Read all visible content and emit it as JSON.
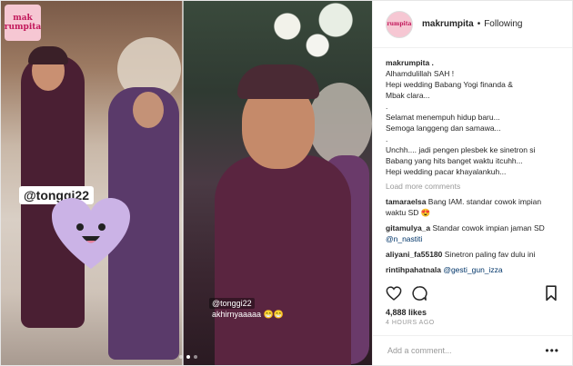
{
  "brand": {
    "logo_line1": "mak",
    "logo_line2": "rumpita"
  },
  "media": {
    "tag_text": "@tonggi22",
    "sticker_user": "@tonggi22",
    "sticker_text": "akhirnyaaaaa 😁😁",
    "carousel_dots": 3,
    "active_dot": 1
  },
  "header": {
    "username": "makrumpita",
    "separator": "•",
    "follow_status": "Following"
  },
  "caption": {
    "username": "makrumpita .",
    "lines": [
      "Alhamdulillah SAH !",
      "Hepi wedding Babang Yogi finanda &",
      "Mbak clara...",
      ".",
      "Selamat menempuh hidup baru...",
      "Semoga langgeng dan samawa...",
      ".",
      "Unchh.... jadi pengen plesbek ke sinetron si",
      "Babang yang hits banget waktu itcuhh...",
      "Hepi wedding pacar khayalankuh..."
    ]
  },
  "load_more": "Load more comments",
  "comments": [
    {
      "user": "tamaraelsa",
      "text": "Bang IAM. standar cowok impian waktu SD 😍",
      "mention": ""
    },
    {
      "user": "gitamulya_a",
      "text": "Standar cowok impian jaman SD ",
      "mention": "@n_nastiti"
    },
    {
      "user": "aliyani_fa55180",
      "text": "Sinetron paling fav dulu ini",
      "mention": ""
    },
    {
      "user": "rintihpahatnala",
      "text": "",
      "mention": "@gesti_gun_izza"
    }
  ],
  "stats": {
    "likes": "4,888 likes",
    "time": "4 HOURS AGO"
  },
  "add_comment": {
    "placeholder": "Add a comment...",
    "more": "•••"
  },
  "colors": {
    "brand_pink": "#f6c7d3",
    "link": "#003569",
    "muted": "#999999"
  }
}
